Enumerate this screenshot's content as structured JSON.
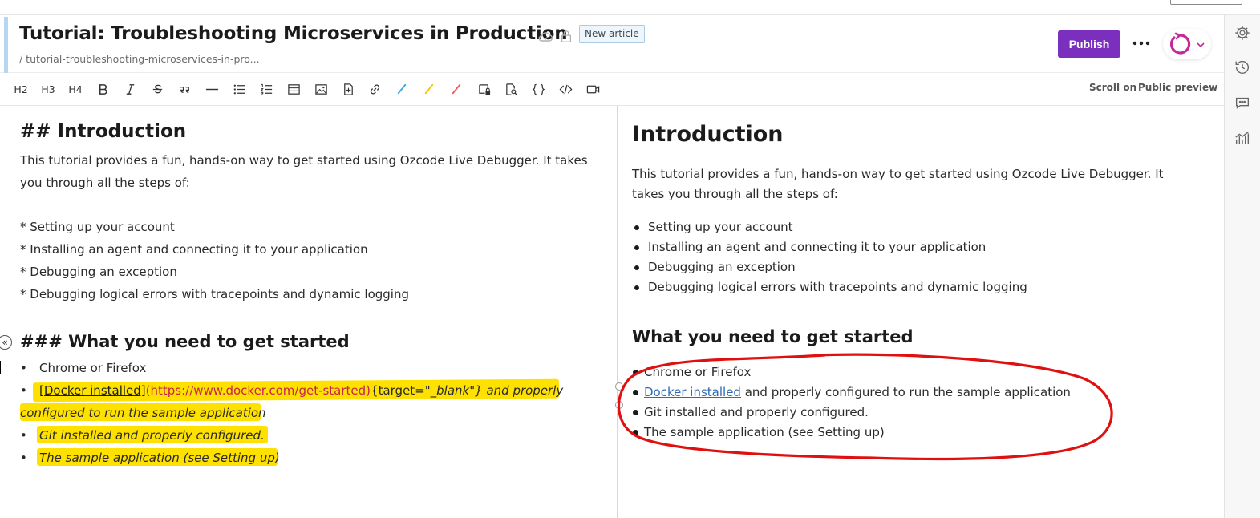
{
  "header": {
    "title": "Tutorial: Troubleshooting Microservices in Production",
    "badge": "New article",
    "slug": "/ tutorial-troubleshooting-microservices-in-pro...",
    "publish_label": "Publish",
    "more_label": "•••"
  },
  "toolbar": {
    "h2": "H2",
    "h3": "H3",
    "h4": "H4",
    "scroll_on": "Scroll on",
    "public_preview": "Public preview"
  },
  "editor": {
    "h2": "## Introduction",
    "intro": "This tutorial provides a fun, hands-on way to get started using Ozcode Live Debugger. It takes you through all the steps of:",
    "list": [
      "* Setting up your account",
      "* Installing an agent and connecting it to your application",
      "* Debugging an exception",
      "* Debugging logical errors with tracepoints and dynamic logging"
    ],
    "h3": "### What you need to get started",
    "bullet": "•",
    "req1": "Chrome or Firefox",
    "req2_link": "[Docker installed]",
    "req2_url": "(https://www.docker.com/get-started)",
    "req2_attr": "{target=\"",
    "req2_attr_it": "_blank\"}",
    "req2_rest_line1": " and properly",
    "req2_rest_line2": "configured to run the sample application",
    "req3": "Git installed and properly configured.",
    "req4": "The sample application (see Setting up)",
    "collapse_label": "«"
  },
  "preview": {
    "h2": "Introduction",
    "intro": "This tutorial provides a fun, hands-on way to get started using Ozcode Live Debugger. It takes you through all the steps of:",
    "list": [
      "Setting up your account",
      "Installing an agent and connecting it to your application",
      "Debugging an exception",
      "Debugging logical errors with tracepoints and dynamic logging"
    ],
    "h3": "What you need to get started",
    "req1": "Chrome or Firefox",
    "req2_link": "Docker installed",
    "req2_rest": " and properly configured to run the sample application",
    "req3": "Git installed and properly configured.",
    "req4": "The sample application (see Setting up)"
  },
  "colors": {
    "publish": "#7b2fbf",
    "highlight": "#ffe100",
    "annotation": "#e01010",
    "accent_bar": "#b6d6f2",
    "logo": "#c4289b"
  },
  "icons": {
    "header": [
      "cloud-icon",
      "lock-icon"
    ],
    "sidebar": [
      "gear-icon",
      "history-icon",
      "comment-icon",
      "analytics-icon"
    ],
    "toolbar": [
      "bold-icon",
      "italic-icon",
      "strikethrough-icon",
      "quote-icon",
      "horizontal-rule-icon",
      "bullet-list-icon",
      "numbered-list-icon",
      "table-icon",
      "image-icon",
      "file-icon",
      "link-icon",
      "blue-pen-icon",
      "yellow-pen-icon",
      "red-pen-icon",
      "locked-page-icon",
      "search-page-icon",
      "braces-icon",
      "code-icon",
      "video-icon"
    ]
  }
}
